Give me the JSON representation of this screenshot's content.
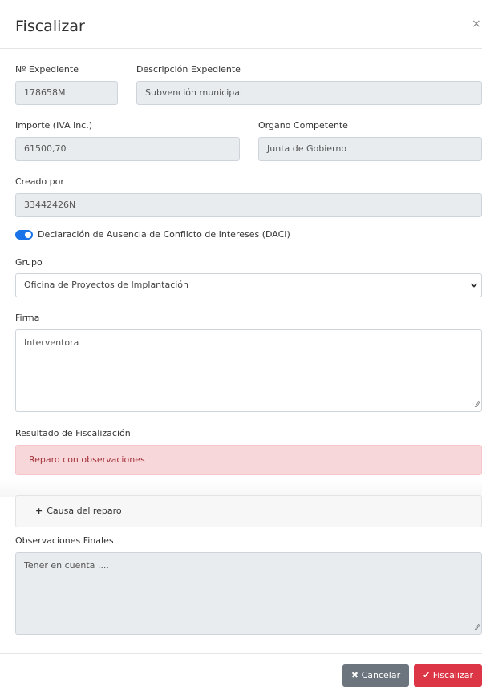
{
  "modal": {
    "title": "Fiscalizar",
    "close_symbol": "×"
  },
  "fields": {
    "expediente": {
      "label": "Nº Expediente",
      "value": "178658M"
    },
    "descripcion": {
      "label": "Descripción Expediente",
      "value": "Subvención municipal"
    },
    "importe": {
      "label": "Importe (IVA inc.)",
      "value": "61500,70"
    },
    "organo": {
      "label": "Organo Competente",
      "value": "Junta de Gobierno"
    },
    "creado": {
      "label": "Creado por",
      "value": "33442426N"
    }
  },
  "daci": {
    "label": "Declaración de Ausencia de Conflicto de Intereses (DACI)",
    "checked": true,
    "color": "#1a73e8"
  },
  "grupo": {
    "label": "Grupo",
    "selected": "Oficina de Proyectos de Implantación"
  },
  "firma": {
    "label": "Firma",
    "value": "Interventora"
  },
  "resultado": {
    "label": "Resultado de Fiscalización",
    "value": "Reparo con observaciones",
    "color": "#f8d7da"
  },
  "causa": {
    "plus": "+",
    "label": "Causa del reparo"
  },
  "observaciones": {
    "label": "Observaciones Finales",
    "value": "Tener en cuenta ...."
  },
  "buttons": {
    "cancel": {
      "icon": "✖",
      "label": "Cancelar",
      "color": "#6c757d"
    },
    "submit": {
      "icon": "✔",
      "label": "Fiscalizar",
      "color": "#dc3545"
    }
  }
}
